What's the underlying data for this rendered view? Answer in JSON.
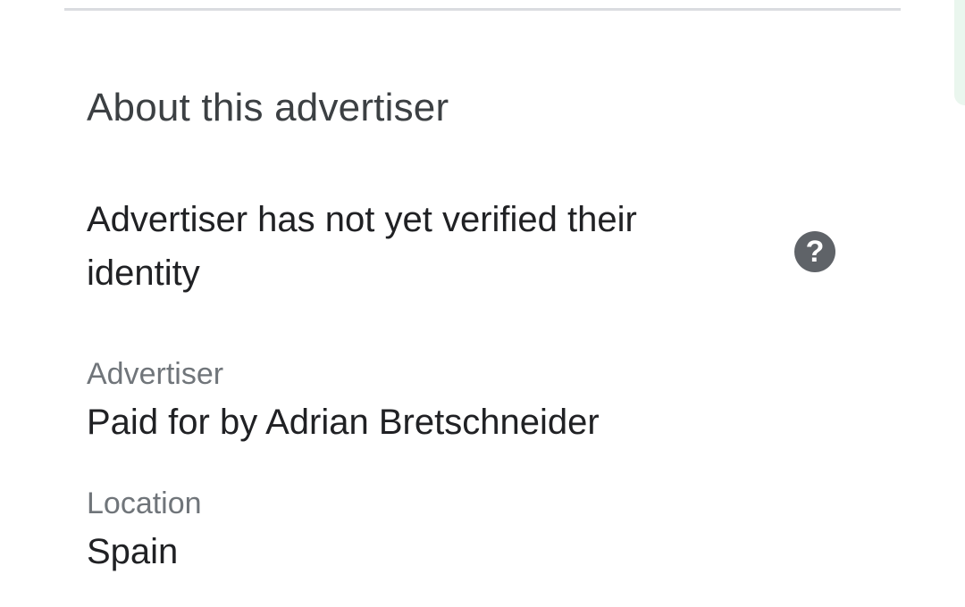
{
  "section": {
    "title": "About this advertiser"
  },
  "verification": {
    "status_text": "Advertiser has not yet verified their identity",
    "help_icon": "help-circle-icon",
    "help_glyph": "?"
  },
  "fields": {
    "advertiser": {
      "label": "Advertiser",
      "value": "Paid for by Adrian Bretschneider"
    },
    "location": {
      "label": "Location",
      "value": "Spain"
    }
  },
  "colors": {
    "title": "#3c4043",
    "body_text": "#202124",
    "secondary_text": "#70757a",
    "icon_bg": "#5f6368",
    "divider": "#dadce0",
    "edge_accent": "#eaf6ee"
  }
}
